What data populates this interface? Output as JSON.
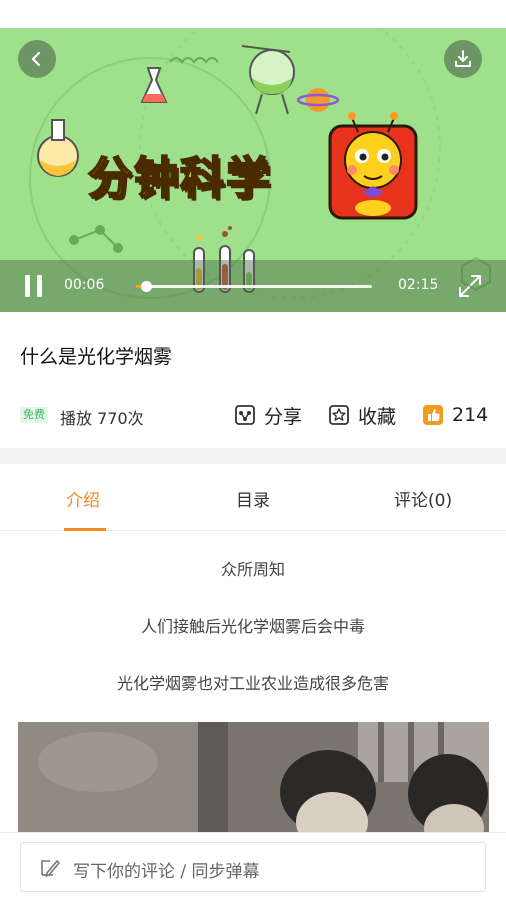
{
  "player": {
    "title_card": "分钟科学",
    "current_time": "00:06",
    "total_time": "02:15",
    "progress": 0.044,
    "state": "playing",
    "bg_color": "#9ee18a"
  },
  "video": {
    "title": "什么是光化学烟雾",
    "free_badge": "免费",
    "plays": "播放 770次"
  },
  "actions": {
    "share": "分享",
    "collect": "收藏",
    "likes": "214"
  },
  "tabs": [
    {
      "label": "介绍",
      "active": true
    },
    {
      "label": "目录",
      "active": false
    },
    {
      "label": "评论(0)",
      "active": false
    }
  ],
  "intro": {
    "lines": [
      "众所周知",
      "人们接触后光化学烟雾后会中毒",
      "光化学烟雾也对工业农业造成很多危害"
    ]
  },
  "comment_bar": {
    "placeholder": "写下你的评论 / 同步弹幕"
  },
  "colors": {
    "accent": "#f08b1c",
    "free_badge_text": "#3cb86a"
  },
  "icons": [
    "back-icon",
    "download-icon",
    "pause-icon",
    "fullscreen-icon",
    "share-icon",
    "star-icon",
    "thumbs-up-icon",
    "pen-icon"
  ]
}
